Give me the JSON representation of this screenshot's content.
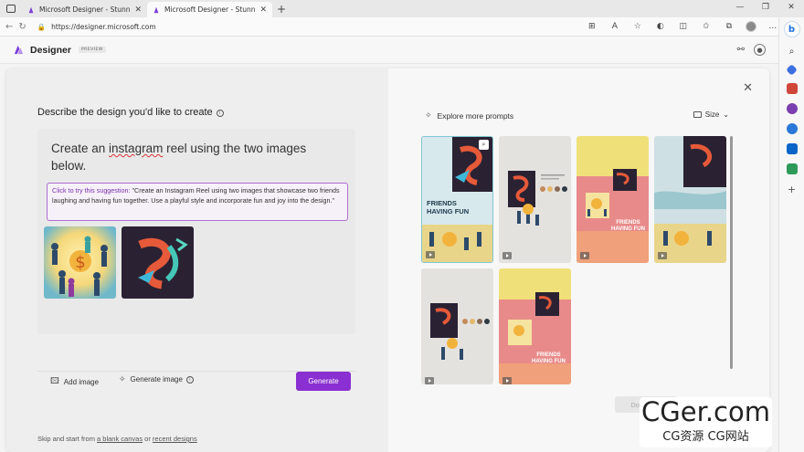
{
  "browser": {
    "tabs": [
      {
        "title": "Microsoft Designer - Stunning d",
        "active": false
      },
      {
        "title": "Microsoft Designer - Stunning d",
        "active": true
      }
    ],
    "url": "https://designer.microsoft.com"
  },
  "app": {
    "brand": "Designer",
    "badge": "PREVIEW"
  },
  "create": {
    "title": "Describe the design you'd like to create",
    "prompt_before": "Create an ",
    "prompt_misspelled": "instagram",
    "prompt_after": " reel using the two images below.",
    "suggestion_lead": "Click to try this suggestion:",
    "suggestion_text": " \"Create an Instagram Reel using two images that showcase two friends laughing and having fun together. Use a playful style and incorporate fun and joy into the design.\"",
    "add_image": "Add image",
    "generate_image": "Generate image",
    "generate_button": "Generate",
    "skip_prefix": "Skip and start from ",
    "blank_canvas": "a blank canvas",
    "skip_or": " or ",
    "recent_designs": "recent designs"
  },
  "results": {
    "explore": "Explore more prompts",
    "size": "Size",
    "download": "Download",
    "card_caption_1": "FRIENDS HAVING FUN",
    "card_caption_2": "FRIENDS HAVING FUN"
  },
  "watermark": {
    "line1": "CGer.com",
    "line2": "CG资源 CG网站"
  },
  "colors": {
    "accent": "#8a2fd1",
    "suggestion_border": "#b06cd0"
  }
}
